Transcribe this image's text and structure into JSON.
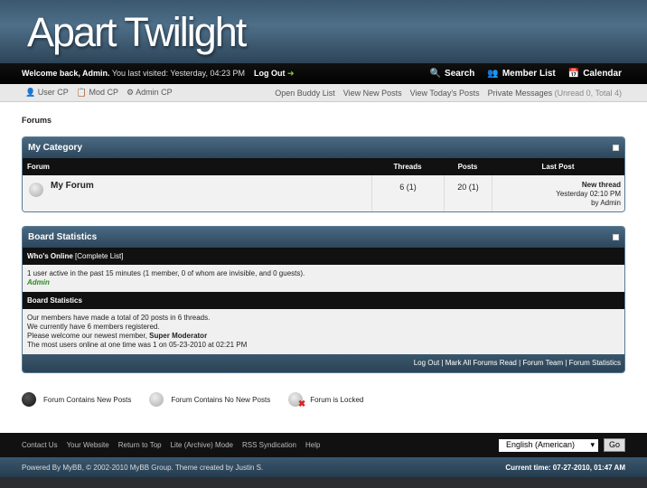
{
  "header": {
    "logo": "Apart Twilight"
  },
  "userbar": {
    "welcome": "Welcome back, Admin.",
    "last_visit": " You last visited: Yesterday, 04:23 PM",
    "logout": "Log Out",
    "search": "Search",
    "member_list": "Member List",
    "calendar": "Calendar"
  },
  "panel": {
    "left": [
      "User CP",
      "Mod CP",
      "Admin CP"
    ],
    "right": [
      "Open Buddy List",
      "View New Posts",
      "View Today's Posts"
    ],
    "pm": "Private Messages",
    "pm_stats": "(Unread 0, Total 4)"
  },
  "page_title": "Forums",
  "category": {
    "title": "My Category",
    "columns": [
      "Forum",
      "Threads",
      "Posts",
      "Last Post"
    ],
    "forum": {
      "name": "My Forum",
      "threads": "6 (1)",
      "posts": "20 (1)",
      "last_post_title": "New thread",
      "last_post_time": "Yesterday 02:10 PM",
      "last_post_by": "by Admin"
    }
  },
  "stats": {
    "title": "Board Statistics",
    "whos_online": "Who's Online",
    "complete_list": "[Complete List]",
    "online_text": "1 user active in the past 15 minutes (1 member, 0 of whom are invisible, and 0 guests).",
    "online_user": "Admin",
    "board_stats_label": "Board Statistics",
    "lines": [
      "Our members have made a total of 20 posts in 6 threads.",
      "We currently have 6 members registered.",
      "Please welcome our newest member, ",
      "The most users online at one time was 1 on 05-23-2010 at 02:21 PM"
    ],
    "newest_member": "Super Moderator",
    "footer_links": "Log Out | Mark All Forums Read | Forum Team | Forum Statistics"
  },
  "legend": {
    "new": "Forum Contains New Posts",
    "nonew": "Forum Contains No New Posts",
    "locked": "Forum is Locked"
  },
  "bottom": {
    "links": [
      "Contact Us",
      "Your Website",
      "Return to Top",
      "Lite (Archive) Mode",
      "RSS Syndication",
      "Help"
    ],
    "language": "English (American)",
    "go": "Go"
  },
  "copyright": {
    "text": "Powered By MyBB, © 2002-2010 MyBB Group. Theme created by Justin S.",
    "time": "Current time: 07-27-2010, 01:47 AM"
  }
}
